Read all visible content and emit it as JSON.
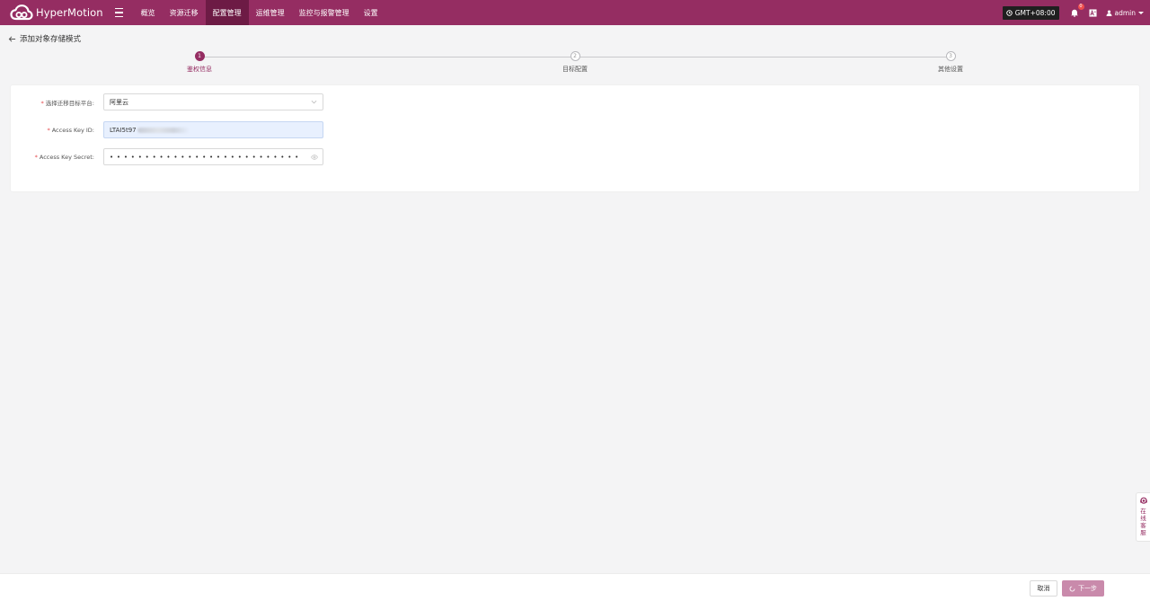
{
  "app": {
    "name": "HyperMotion",
    "brand_color": "#952d62",
    "active_nav_color": "#6d1b45"
  },
  "nav": {
    "items": [
      {
        "label": "概览"
      },
      {
        "label": "资源迁移"
      },
      {
        "label": "配置管理",
        "active": true
      },
      {
        "label": "运维管理"
      },
      {
        "label": "监控与报警管理"
      },
      {
        "label": "设置"
      }
    ]
  },
  "header": {
    "timezone": "GMT+08:00",
    "notification_count": "0",
    "user": "admin"
  },
  "page": {
    "title": "添加对象存储模式"
  },
  "steps": [
    {
      "number": "1",
      "label": "鉴权信息",
      "active": true
    },
    {
      "number": "2",
      "label": "目标配置",
      "active": false
    },
    {
      "number": "3",
      "label": "其他设置",
      "active": false
    }
  ],
  "form": {
    "platform": {
      "label": "选择迁移目标平台:",
      "value": "阿里云"
    },
    "access_key_id": {
      "label": "Access Key ID:",
      "value": "LTAI5t97"
    },
    "access_key_secret": {
      "label": "Access Key Secret:",
      "value": "••••••••••••••••••••••••••••••"
    }
  },
  "service_tab": {
    "label": "在线客服"
  },
  "footer": {
    "cancel_label": "取消",
    "next_label": "下一步"
  }
}
